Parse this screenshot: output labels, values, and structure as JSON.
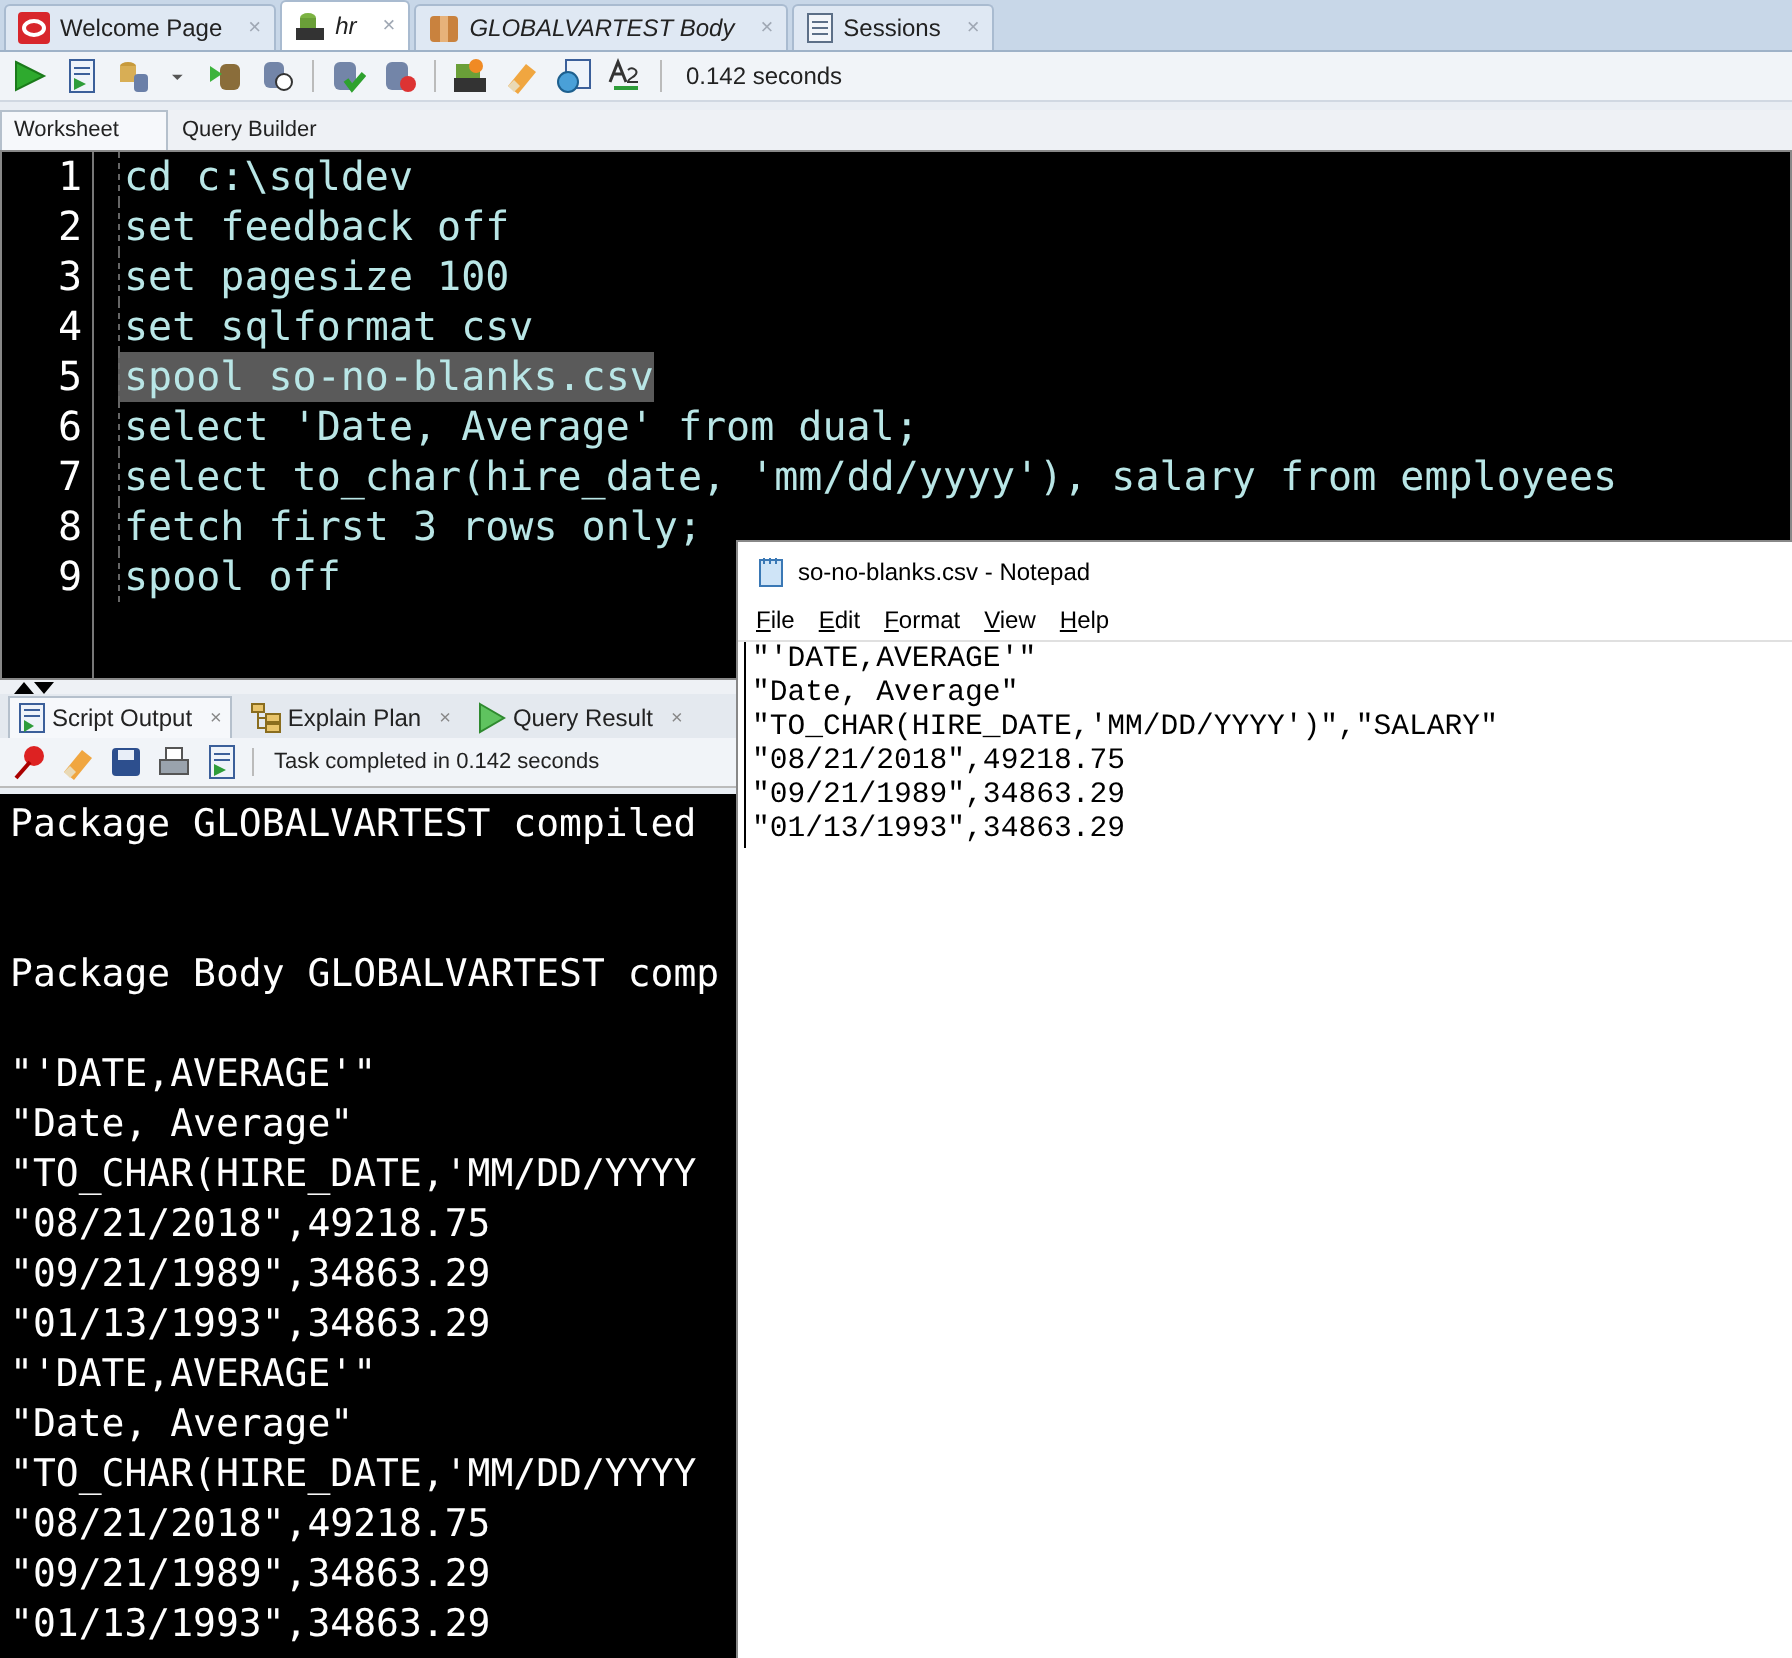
{
  "document_tabs": [
    {
      "label": "Welcome Page",
      "selected": false,
      "italic": false,
      "kind": "oracle",
      "close": "×"
    },
    {
      "label": "hr",
      "selected": true,
      "italic": true,
      "kind": "sql",
      "close": "×"
    },
    {
      "label": "GLOBALVARTEST Body",
      "selected": false,
      "italic": true,
      "kind": "package",
      "close": "×"
    },
    {
      "label": "Sessions",
      "selected": false,
      "italic": false,
      "kind": "sessions",
      "close": "×"
    }
  ],
  "toolbar": {
    "timing": "0.142 seconds"
  },
  "worksheet_tabs": [
    {
      "label": "Worksheet",
      "selected": true
    },
    {
      "label": "Query Builder",
      "selected": false
    }
  ],
  "editor": {
    "lines": [
      {
        "number": "1",
        "text": "cd c:\\sqldev",
        "highlighted": false
      },
      {
        "number": "2",
        "text": "set feedback off",
        "highlighted": false
      },
      {
        "number": "3",
        "text": "set pagesize 100",
        "highlighted": false
      },
      {
        "number": "4",
        "text": "set sqlformat csv",
        "highlighted": false
      },
      {
        "number": "5",
        "text": "spool so-no-blanks.csv",
        "highlighted": true
      },
      {
        "number": "6",
        "text": "select 'Date, Average' from dual;",
        "highlighted": false
      },
      {
        "number": "7",
        "text": "select to_char(hire_date, 'mm/dd/yyyy'), salary from employees",
        "highlighted": false
      },
      {
        "number": "8",
        "text": "fetch first 3 rows only;",
        "highlighted": false
      },
      {
        "number": "9",
        "text": "spool off",
        "highlighted": false
      }
    ]
  },
  "output_tabs": [
    {
      "label": "Script Output",
      "selected": true,
      "kind": "script",
      "close": "×"
    },
    {
      "label": "Explain Plan",
      "selected": false,
      "kind": "plan",
      "close": "×"
    },
    {
      "label": "Query Result",
      "selected": false,
      "kind": "query",
      "close": "×"
    }
  ],
  "output_status": "Task completed in 0.142 seconds",
  "output_lines": [
    {
      "text": "Package GLOBALVARTEST compiled",
      "kind": "message"
    },
    {
      "text": "Package Body GLOBALVARTEST comp",
      "kind": "message"
    },
    {
      "text": "\"'DATE,AVERAGE'\"",
      "kind": "row"
    },
    {
      "text": "\"Date, Average\"",
      "kind": "row"
    },
    {
      "text": "\"TO_CHAR(HIRE_DATE,'MM/DD/YYYY",
      "kind": "row"
    },
    {
      "text": "\"08/21/2018\",49218.75",
      "kind": "row"
    },
    {
      "text": "\"09/21/1989\",34863.29",
      "kind": "row"
    },
    {
      "text": "\"01/13/1993\",34863.29",
      "kind": "row"
    },
    {
      "text": "\"'DATE,AVERAGE'\"",
      "kind": "row"
    },
    {
      "text": "\"Date, Average\"",
      "kind": "row"
    },
    {
      "text": "\"TO_CHAR(HIRE_DATE,'MM/DD/YYYY",
      "kind": "row"
    },
    {
      "text": "\"08/21/2018\",49218.75",
      "kind": "row"
    },
    {
      "text": "\"09/21/1989\",34863.29",
      "kind": "row"
    },
    {
      "text": "\"01/13/1993\",34863.29",
      "kind": "row"
    }
  ],
  "notepad": {
    "title": "so-no-blanks.csv - Notepad",
    "menu": [
      "File",
      "Edit",
      "Format",
      "View",
      "Help"
    ],
    "lines": [
      "\"'DATE,AVERAGE'\"",
      "\"Date, Average\"",
      "\"TO_CHAR(HIRE_DATE,'MM/DD/YYYY')\",\"SALARY\"",
      "\"08/21/2018\",49218.75",
      "\"09/21/1989\",34863.29",
      "\"01/13/1993\",34863.29"
    ]
  }
}
